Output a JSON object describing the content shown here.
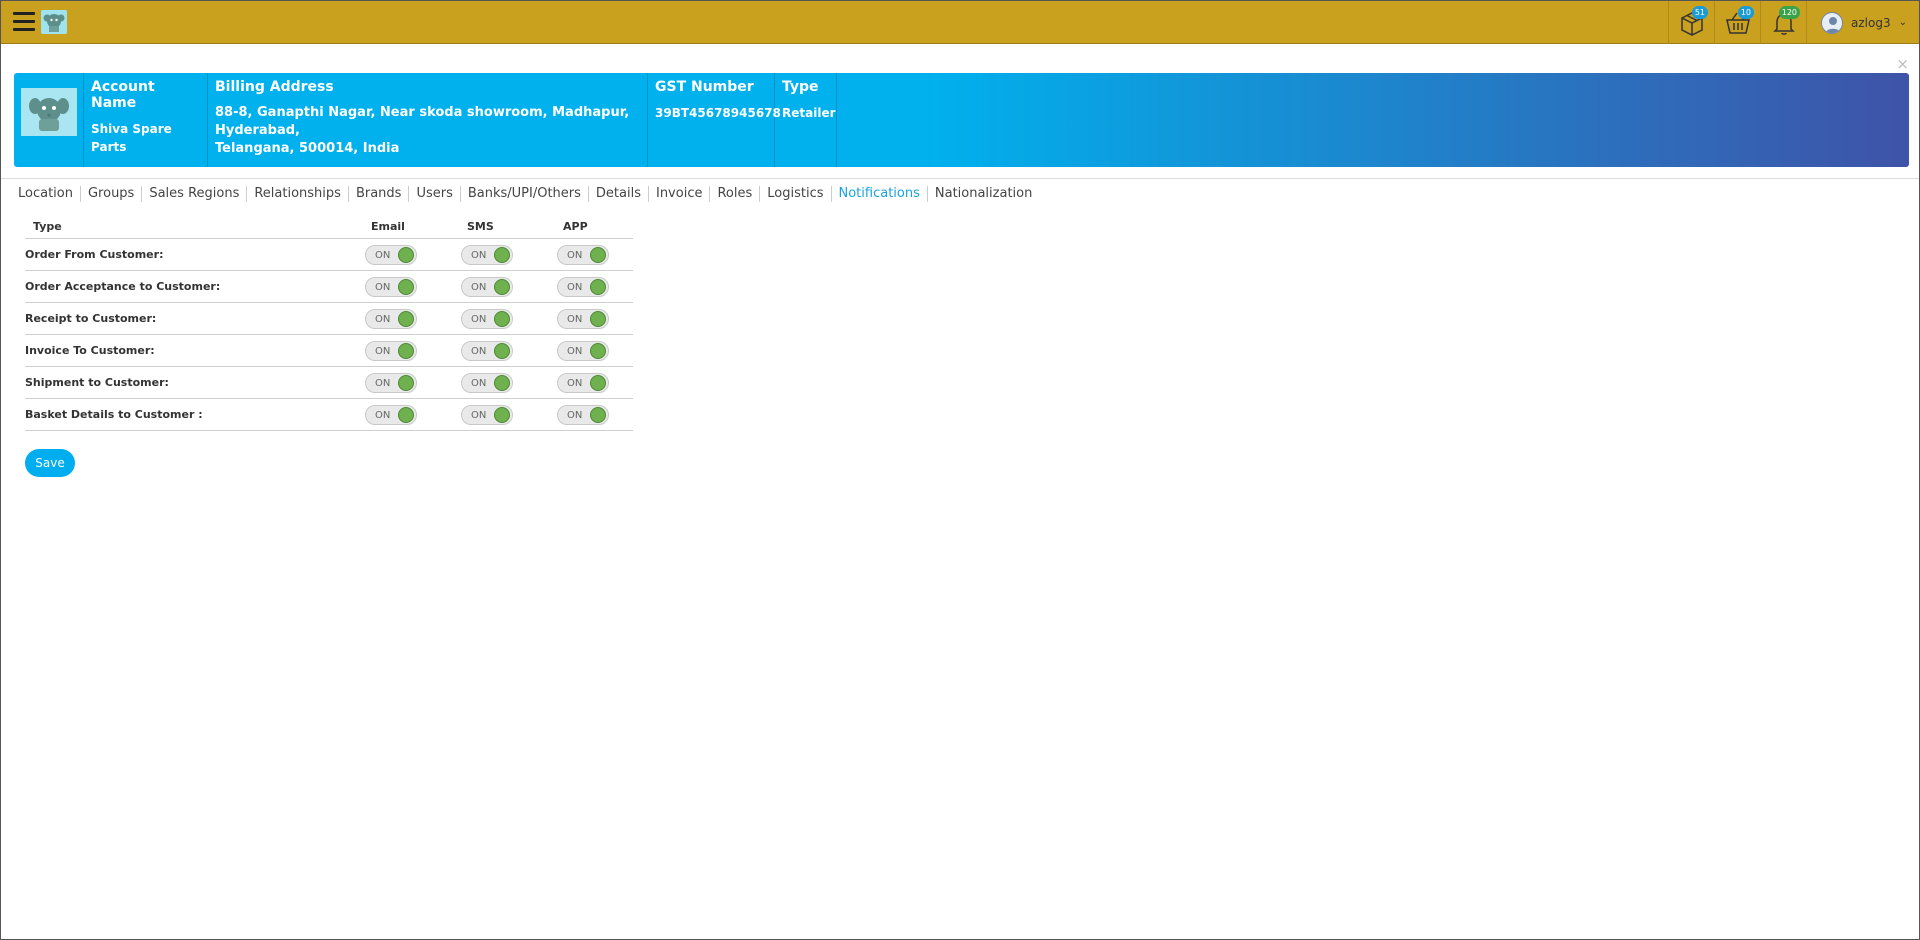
{
  "topbar": {
    "badges": {
      "products": "51",
      "basket": "10",
      "notifications": "120"
    },
    "username": "azlog3",
    "icons": [
      "menu-icon",
      "app-logo",
      "box-icon",
      "basket-icon",
      "bell-icon",
      "user-avatar-icon",
      "chevron-down-icon"
    ]
  },
  "close_label": "×",
  "account": {
    "name_label": "Account Name",
    "name_value": "Shiva Spare Parts",
    "address_label": "Billing Address",
    "address_line1": "88-8, Ganapthi Nagar, Near skoda showroom, Madhapur,",
    "address_line2": "Hyderabad,",
    "address_line3": "Telangana, 500014, India",
    "gst_label": "GST Number",
    "gst_value": "39BT45678945678",
    "type_label": "Type",
    "type_value": "Retailer"
  },
  "tabs": [
    {
      "label": "Location"
    },
    {
      "label": "Groups"
    },
    {
      "label": "Sales Regions"
    },
    {
      "label": "Relationships"
    },
    {
      "label": "Brands"
    },
    {
      "label": "Users"
    },
    {
      "label": "Banks/UPI/Others"
    },
    {
      "label": "Details"
    },
    {
      "label": "Invoice"
    },
    {
      "label": "Roles"
    },
    {
      "label": "Logistics"
    },
    {
      "label": "Notifications",
      "active": true
    },
    {
      "label": "Nationalization"
    }
  ],
  "table": {
    "headers": {
      "type": "Type",
      "email": "Email",
      "sms": "SMS",
      "app": "APP"
    },
    "rows": [
      {
        "type": "Order From Customer:",
        "email": "ON",
        "sms": "ON",
        "app": "ON"
      },
      {
        "type": "Order Acceptance to Customer:",
        "email": "ON",
        "sms": "ON",
        "app": "ON"
      },
      {
        "type": "Receipt to Customer:",
        "email": "ON",
        "sms": "ON",
        "app": "ON"
      },
      {
        "type": "Invoice To Customer:",
        "email": "ON",
        "sms": "ON",
        "app": "ON"
      },
      {
        "type": "Shipment to Customer:",
        "email": "ON",
        "sms": "ON",
        "app": "ON"
      },
      {
        "type": "Basket Details to Customer :",
        "email": "ON",
        "sms": "ON",
        "app": "ON"
      }
    ]
  },
  "save_label": "Save",
  "colors": {
    "topbar": "#c9a11e",
    "accent": "#00aeef",
    "header_start": "#00b1ed",
    "header_end": "#3f53a8",
    "toggle_on": "#6fb04f",
    "active_tab": "#1aa3dc"
  }
}
